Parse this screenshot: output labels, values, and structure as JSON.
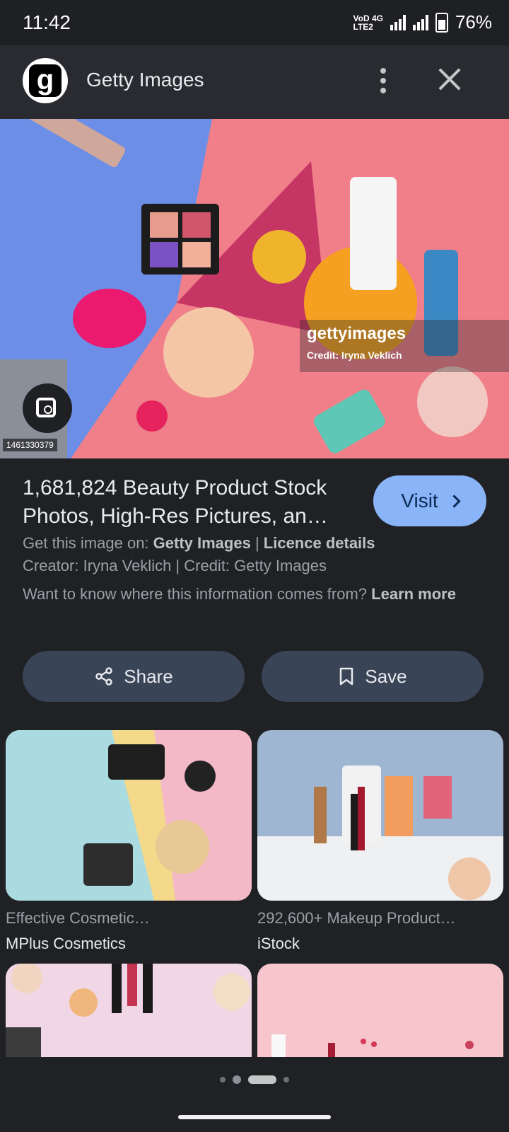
{
  "status": {
    "time": "11:42",
    "network_top": "VoD 4G",
    "network_bottom": "LTE2",
    "battery": "76%"
  },
  "header": {
    "site_title": "Getty Images",
    "logo_letter": "g"
  },
  "image": {
    "watermark_logo": "gettyimages",
    "watermark_credit": "Credit: Iryna Veklich",
    "id": "1461330379"
  },
  "result": {
    "title": "1,681,824 Beauty Product Stock Photos, High-Res Pictures, an…",
    "visit_label": "Visit",
    "get_image_prefix": "Get this image on: ",
    "get_image_source": "Getty Images",
    "separator": " | ",
    "licence": "Licence details",
    "creator_line": "Creator: Iryna Veklich | Credit: Getty Images",
    "info_question": "Want to know where this information comes from? ",
    "learn_more": "Learn more"
  },
  "actions": {
    "share_label": "Share",
    "save_label": "Save"
  },
  "related": [
    {
      "title": "Effective Cosmetic…",
      "source": "MPlus Cosmetics"
    },
    {
      "title": "292,600+ Makeup Product…",
      "source": "iStock"
    },
    {
      "title": "",
      "source": ""
    },
    {
      "title": "",
      "source": ""
    }
  ],
  "pager": {
    "count": 4,
    "active_index": 2
  },
  "colors": {
    "accent": "#8ab4f8",
    "button_bg": "#394457",
    "background": "#202124"
  }
}
